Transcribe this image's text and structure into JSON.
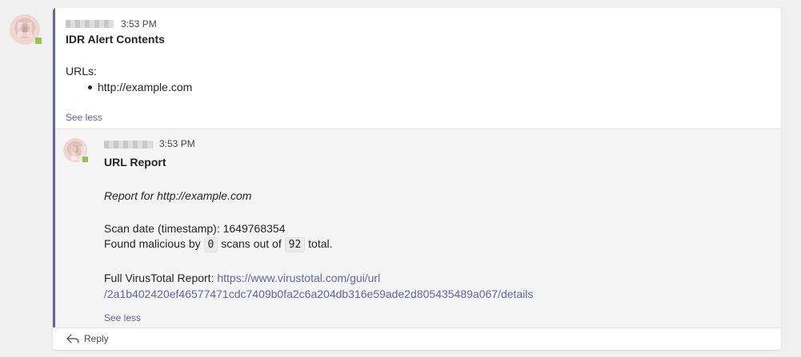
{
  "message": {
    "time": "3:53 PM",
    "title": "IDR Alert Contents",
    "urls_label": "URLs:",
    "urls": [
      "http://example.com"
    ],
    "see_less": "See less"
  },
  "reply": {
    "time": "3:53 PM",
    "title": "URL Report",
    "report_for": "Report for http://example.com",
    "scan_date_label": "Scan date (timestamp): 1649768354",
    "found_prefix": "Found malicious by",
    "malicious_count": "0",
    "found_middle": "scans out of",
    "total_count": "92",
    "found_suffix": "total.",
    "full_report_label": "Full VirusTotal Report:",
    "full_report_link_line1": "https://www.virustotal.com/gui/url",
    "full_report_link_line2": "/2a1b402420ef46577471cdc7409b0fa2c6a204db316e59ade2d805435489a067/details",
    "see_less": "See less"
  },
  "footer": {
    "reply_label": "Reply"
  },
  "colors": {
    "accent": "#6264a7",
    "presence": "#92c353",
    "background": "#f0f0f0"
  }
}
